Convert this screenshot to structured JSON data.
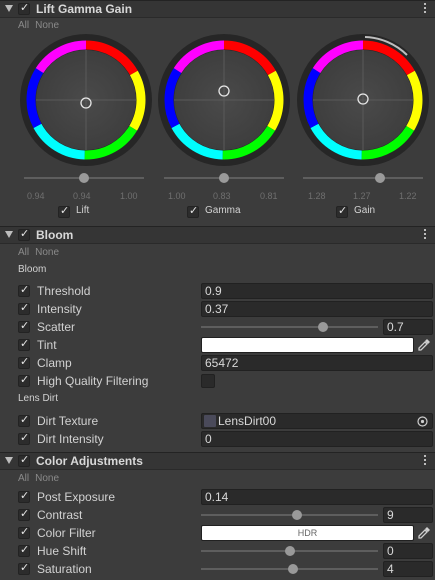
{
  "common": {
    "all": "All",
    "none": "None"
  },
  "lgg": {
    "title": "Lift Gamma Gain",
    "wheels": [
      {
        "label": "Lift",
        "values": [
          "0.94",
          "0.94",
          "1.00"
        ]
      },
      {
        "label": "Gamma",
        "values": [
          "1.00",
          "0.83",
          "0.81"
        ]
      },
      {
        "label": "Gain",
        "values": [
          "1.28",
          "1.27",
          "1.22"
        ]
      }
    ]
  },
  "bloom": {
    "title": "Bloom",
    "subheader": "Bloom",
    "lens_subheader": "Lens Dirt",
    "rows": {
      "threshold": {
        "label": "Threshold",
        "value": "0.9"
      },
      "intensity": {
        "label": "Intensity",
        "value": "0.37"
      },
      "scatter": {
        "label": "Scatter",
        "value": "0.7",
        "level": 0.7
      },
      "tint": {
        "label": "Tint",
        "color": "#ffffff"
      },
      "clamp": {
        "label": "Clamp",
        "value": "65472"
      },
      "hqf": {
        "label": "High Quality Filtering",
        "checked": false
      },
      "dirt_texture": {
        "label": "Dirt Texture",
        "value": "LensDirt00"
      },
      "dirt_intensity": {
        "label": "Dirt Intensity",
        "value": "0"
      }
    }
  },
  "color_adjustments": {
    "title": "Color Adjustments",
    "rows": {
      "post_exposure": {
        "label": "Post Exposure",
        "value": "0.14"
      },
      "contrast": {
        "label": "Contrast",
        "value": "9",
        "level": 0.545
      },
      "color_filter": {
        "label": "Color Filter",
        "badge": "HDR",
        "color": "#ffffff"
      },
      "hue_shift": {
        "label": "Hue Shift",
        "value": "0",
        "level": 0.5
      },
      "saturation": {
        "label": "Saturation",
        "value": "4",
        "level": 0.52
      }
    }
  },
  "icons": {
    "foldout": "foldout-arrow-icon",
    "menu": "kebab-menu-icon",
    "eyedropper": "eyedropper-icon",
    "object_picker": "object-picker-icon"
  }
}
